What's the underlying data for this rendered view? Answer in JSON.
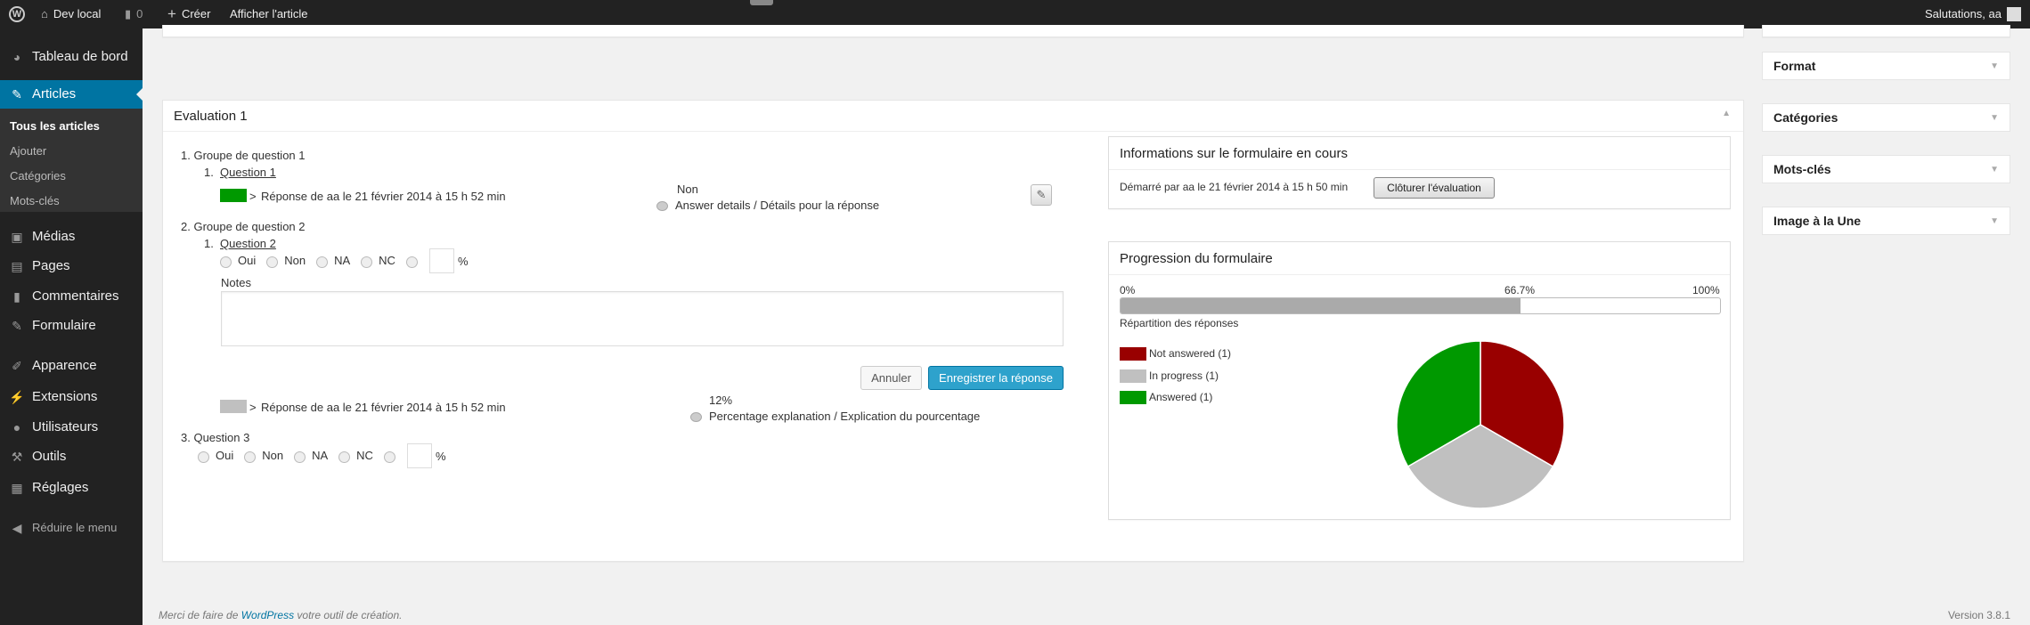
{
  "adminbar": {
    "site": "Dev local",
    "comments": "0",
    "new": "Créer",
    "view": "Afficher l'article",
    "greeting": "Salutations, aa"
  },
  "sidebar": {
    "items": [
      {
        "label": "Tableau de bord",
        "icon": "dashboard-icon"
      },
      {
        "label": "Articles",
        "icon": "pin-icon"
      },
      {
        "label": "Médias",
        "icon": "media-icon"
      },
      {
        "label": "Pages",
        "icon": "pages-icon"
      },
      {
        "label": "Commentaires",
        "icon": "comment-icon"
      },
      {
        "label": "Formulaire",
        "icon": "pin-icon"
      },
      {
        "label": "Apparence",
        "icon": "brush-icon"
      },
      {
        "label": "Extensions",
        "icon": "plugin-icon"
      },
      {
        "label": "Utilisateurs",
        "icon": "user-icon"
      },
      {
        "label": "Outils",
        "icon": "wrench-icon"
      },
      {
        "label": "Réglages",
        "icon": "settings-icon"
      }
    ],
    "submenu": [
      "Tous les articles",
      "Ajouter",
      "Catégories",
      "Mots-clés"
    ],
    "collapse": "Réduire le menu"
  },
  "evaluation": {
    "title": "Evaluation 1",
    "group1": "1.  Groupe de question 1",
    "q1_num": "1.",
    "q1": "Question 1",
    "q1_response": "Réponse de aa le 21 février 2014 à 15 h 52 min",
    "q1_answer": "Non",
    "q1_details": "Answer details / Détails pour la réponse",
    "group2": "2.  Groupe de question 2",
    "q2_num": "1.",
    "q2": "Question 2",
    "options": [
      "Oui",
      "Non",
      "NA",
      "NC"
    ],
    "percent": "%",
    "notes_label": "Notes",
    "notes_value": "",
    "cancel": "Annuler",
    "save": "Enregistrer la réponse",
    "q2_response": "Réponse de aa le 21 février 2014 à 15 h 52 min",
    "q2_answer": "12%",
    "q2_details": "Percentage explanation / Explication du pourcentage",
    "q3": "3.  Question 3",
    "arrow": ">"
  },
  "info": {
    "title": "Informations sur le formulaire en cours",
    "started": "Démarré par aa le 21 février 2014 à 15 h 50 min",
    "close": "Clôturer l'évaluation"
  },
  "progress": {
    "title": "Progression du formulaire",
    "min": "0%",
    "mid": "66.7%",
    "max": "100%",
    "value": 66.7,
    "repartition": "Répartition des réponses"
  },
  "chart_data": {
    "type": "pie",
    "title": "Répartition des réponses",
    "categories": [
      "Not answered (1)",
      "In progress (1)",
      "Answered (1)"
    ],
    "values": [
      1,
      1,
      1
    ],
    "colors": [
      "#990000",
      "#c0c0c0",
      "#009900"
    ],
    "legend": "left"
  },
  "right": {
    "format": "Format",
    "categories": "Catégories",
    "tags": "Mots-clés",
    "featured": "Image à la Une"
  },
  "footer": {
    "thanks_pre": "Merci de faire de ",
    "wp": "WordPress",
    "thanks_post": " votre outil de création.",
    "version": "Version 3.8.1"
  }
}
